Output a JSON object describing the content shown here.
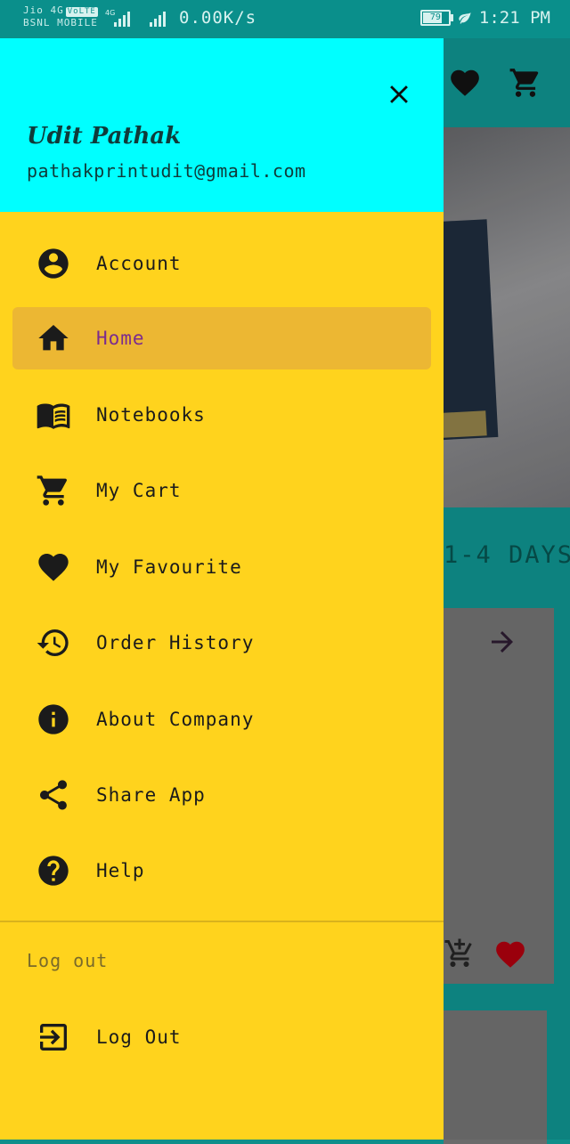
{
  "status_bar": {
    "carrier_line1": "Jio 4G",
    "volte": "VoLTE",
    "carrier_line2": "BSNL MOBILE",
    "network_type": "4G",
    "speed": "0.00K/s",
    "battery": "79",
    "time": "1:21 PM"
  },
  "background": {
    "delivery_text": "1-4 DAYS"
  },
  "drawer": {
    "user_name": "Udit Pathak",
    "user_email": "pathakprintudit@gmail.com",
    "items": [
      {
        "label": "Account",
        "icon": "account-circle-icon"
      },
      {
        "label": "Home",
        "icon": "home-icon",
        "active": true
      },
      {
        "label": "Notebooks",
        "icon": "book-icon"
      },
      {
        "label": "My Cart",
        "icon": "cart-icon"
      },
      {
        "label": "My Favourite",
        "icon": "heart-icon"
      },
      {
        "label": "Order History",
        "icon": "history-icon"
      },
      {
        "label": "About Company",
        "icon": "info-icon"
      },
      {
        "label": "Share App",
        "icon": "share-icon"
      },
      {
        "label": "Help",
        "icon": "help-icon"
      }
    ],
    "section_label": "Log out",
    "logout_label": "Log Out"
  },
  "colors": {
    "header_bg": "#00ffff",
    "drawer_bg": "#ffd31d",
    "active_bg": "#ecb733",
    "active_text": "#7b2b8e",
    "app_bar": "#0e8a86"
  }
}
